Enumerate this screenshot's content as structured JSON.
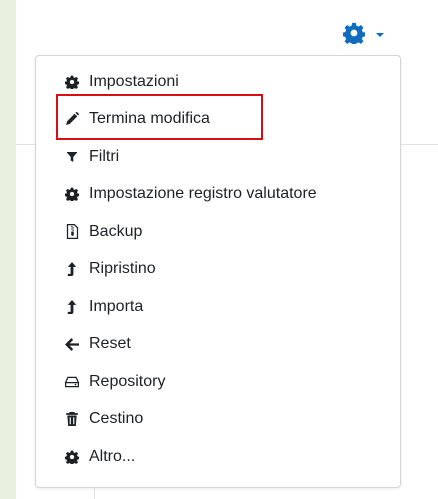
{
  "colors": {
    "outer_background": "#e6f0dc",
    "accent": "#0f6cbf",
    "highlight": "#d90e0e",
    "text": "#1d2125"
  },
  "toolbar": {
    "gear_icon": "gear-icon",
    "caret_icon": "caret-down-icon"
  },
  "menu": {
    "items": [
      {
        "label": "Impostazioni",
        "icon": "cog-icon"
      },
      {
        "label": "Termina modifica",
        "icon": "pencil-icon",
        "highlighted": true
      },
      {
        "label": "Filtri",
        "icon": "filter-icon"
      },
      {
        "label": "Impostazione registro valutatore",
        "icon": "cog-icon"
      },
      {
        "label": "Backup",
        "icon": "file-archive-icon"
      },
      {
        "label": "Ripristino",
        "icon": "level-up-icon"
      },
      {
        "label": "Importa",
        "icon": "level-up-icon"
      },
      {
        "label": "Reset",
        "icon": "arrow-left-icon"
      },
      {
        "label": "Repository",
        "icon": "hdd-icon"
      },
      {
        "label": "Cestino",
        "icon": "trash-icon"
      },
      {
        "label": "Altro...",
        "icon": "cog-icon"
      }
    ]
  }
}
